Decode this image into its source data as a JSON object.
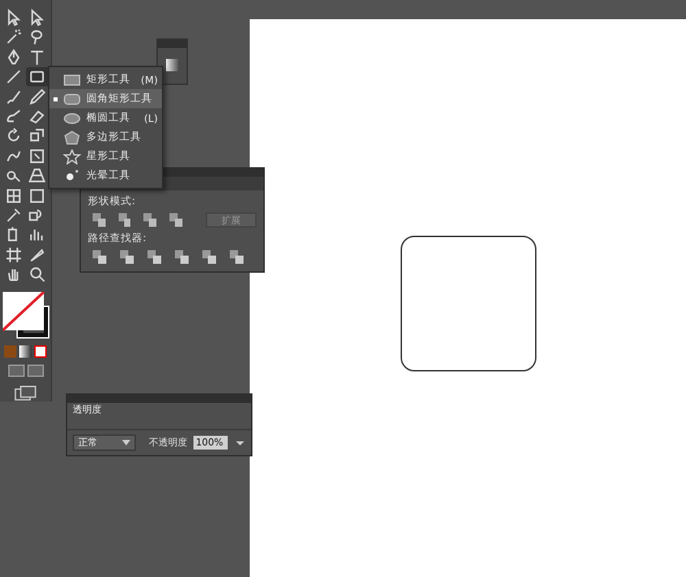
{
  "flyout_menu": {
    "items": [
      {
        "kind": "rect",
        "label": "矩形工具",
        "shortcut": "(M)",
        "selected": false
      },
      {
        "kind": "rounded",
        "label": "圆角矩形工具",
        "selected": true
      },
      {
        "kind": "ellipse",
        "label": "椭圆工具",
        "shortcut": "(L)",
        "selected": false
      },
      {
        "kind": "polygon",
        "label": "多边形工具",
        "selected": false
      },
      {
        "kind": "star",
        "label": "星形工具",
        "selected": false
      },
      {
        "kind": "flare",
        "label": "光晕工具",
        "selected": false
      }
    ]
  },
  "pathfinder_panel": {
    "shape_modes_label": "形状模式:",
    "expand_button": "扩展",
    "pathfinders_label": "路径查找器:"
  },
  "transparency_panel": {
    "tab": "透明度",
    "blend_mode": "正常",
    "opacity_label": "不透明度",
    "opacity_value": "100%"
  }
}
